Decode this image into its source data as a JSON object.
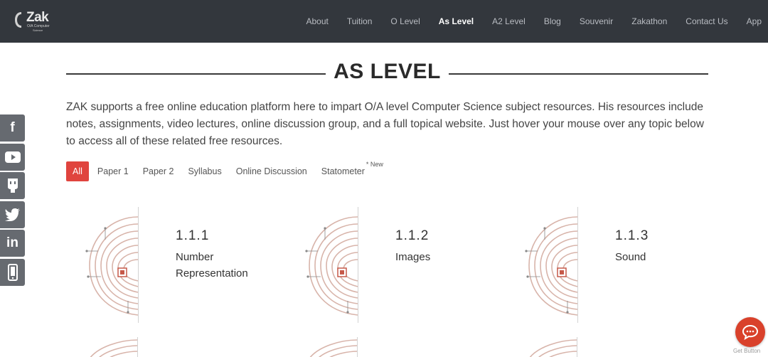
{
  "brand": {
    "name": "Zak",
    "tagline": "O/A Computer",
    "tagline2": "Science"
  },
  "nav": {
    "items": [
      {
        "label": "About"
      },
      {
        "label": "Tuition"
      },
      {
        "label": "O Level"
      },
      {
        "label": "As Level",
        "active": true
      },
      {
        "label": "A2 Level"
      },
      {
        "label": "Blog"
      },
      {
        "label": "Souvenir"
      },
      {
        "label": "Zakathon"
      },
      {
        "label": "Contact Us"
      },
      {
        "label": "App"
      }
    ]
  },
  "main": {
    "title": "AS LEVEL",
    "intro": "ZAK supports a free online education platform here to impart O/A level Computer Science subject resources. His resources include notes, assignments, video lectures, online discussion group, and a full topical website. Just hover your mouse over any topic below to access all of these related free resources."
  },
  "filters": {
    "items": [
      {
        "label": "All",
        "active": true
      },
      {
        "label": "Paper 1"
      },
      {
        "label": "Paper 2"
      },
      {
        "label": "Syllabus"
      },
      {
        "label": "Online Discussion"
      },
      {
        "label": "Statometer",
        "badge": "* New"
      }
    ]
  },
  "topics": [
    {
      "number": "1.1.1",
      "name": "Number Representation"
    },
    {
      "number": "1.1.2",
      "name": "Images"
    },
    {
      "number": "1.1.3",
      "name": "Sound"
    }
  ],
  "social": [
    "facebook-icon",
    "youtube-icon",
    "github-icon",
    "twitter-icon",
    "linkedin-icon",
    "mobile-app-icon"
  ],
  "chat": {
    "label": "Get Button"
  },
  "colors": {
    "header": "#33373d",
    "accent": "#e0443e",
    "sidebar": "#666a70",
    "chat": "#d9412b"
  }
}
